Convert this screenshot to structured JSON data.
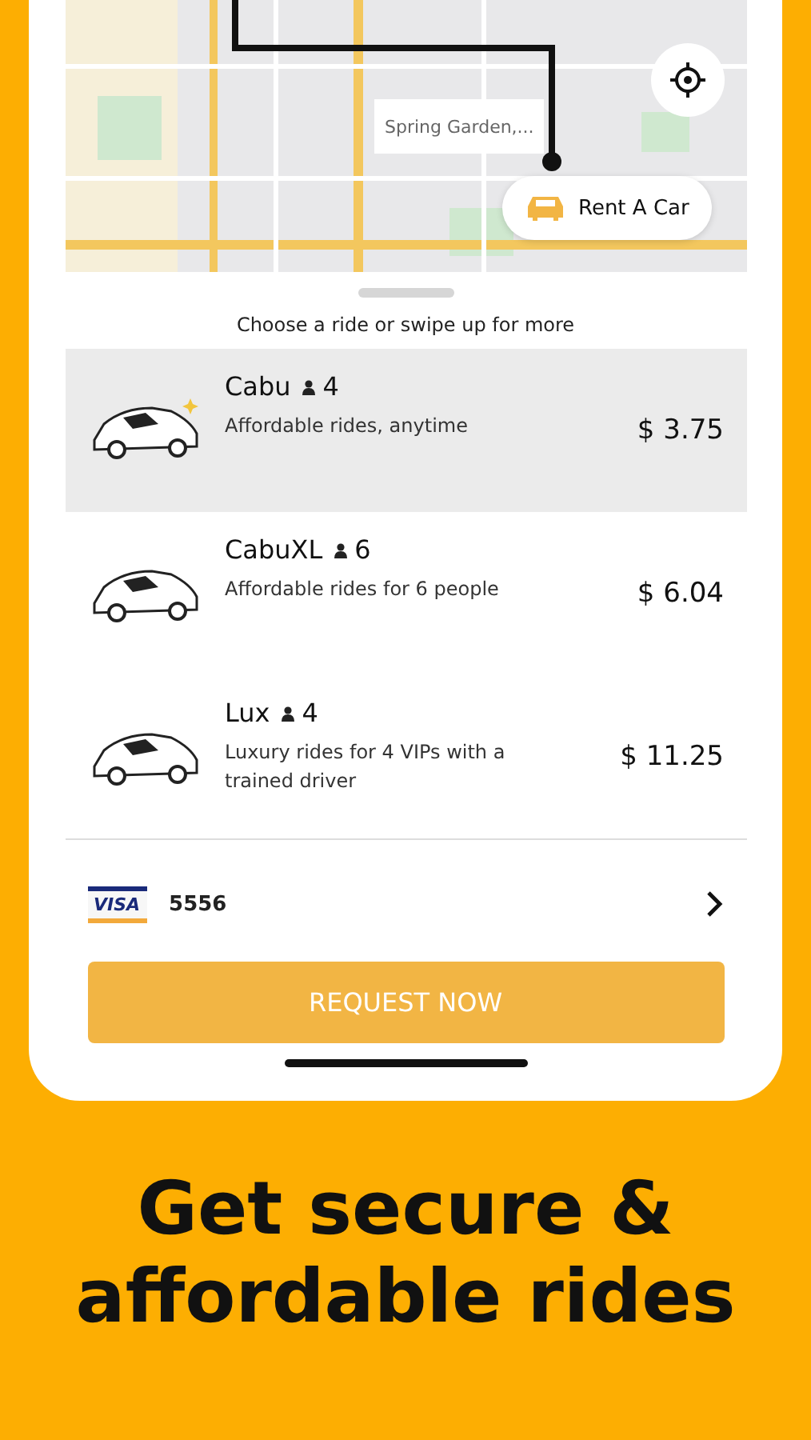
{
  "map": {
    "pin_label": "Spring Garden,...",
    "rent_button": "Rent A Car"
  },
  "sheet": {
    "hint": "Choose a ride or swipe up for more"
  },
  "rides": [
    {
      "name": "Cabu",
      "seats": "4",
      "description": "Affordable rides, anytime",
      "price": "$ 3.75",
      "selected": true
    },
    {
      "name": "CabuXL",
      "seats": "6",
      "description": "Affordable rides for 6 people",
      "price": "$ 6.04",
      "selected": false
    },
    {
      "name": "Lux",
      "seats": "4",
      "description": "Luxury rides for 4 VIPs with a trained driver",
      "price": "$ 11.25",
      "selected": false
    }
  ],
  "payment": {
    "brand": "VISA",
    "last4": "5556"
  },
  "request_button": "REQUEST NOW",
  "headline": "Get secure & affordable rides"
}
